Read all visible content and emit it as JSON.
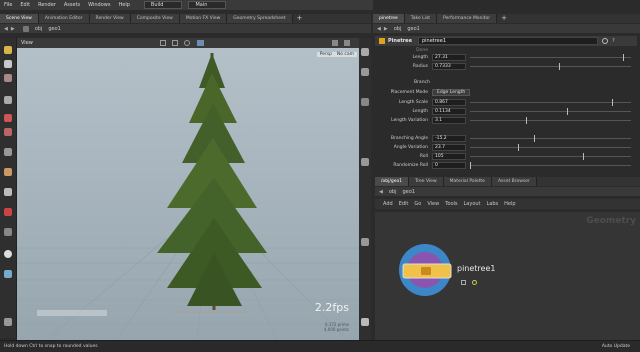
{
  "menu": [
    "File",
    "Edit",
    "Render",
    "Assets",
    "Windows",
    "Help"
  ],
  "desktop_select": "Build",
  "context_select": "Main",
  "left_tabs": [
    "Scene View",
    "Animation Editor",
    "Render View",
    "Composite View",
    "Motion FX View",
    "Geometry Spreadsheet"
  ],
  "right_tabs": [
    "pinetree",
    "Take List",
    "Performance Monitor"
  ],
  "left_path": [
    "obj",
    "geo1"
  ],
  "right_path": [
    "obj",
    "geo1"
  ],
  "vp_view_label": "View",
  "vp_persp": "Persp",
  "vp_cam": "No cam",
  "fps": "2.2fps",
  "vp_stats": [
    "6,172  prims",
    "4,000  points"
  ],
  "node_header": {
    "type": "Pinetree",
    "name": "pinetree1"
  },
  "params_top": [
    {
      "label": "Done",
      "value": ""
    },
    {
      "label": "Length",
      "value": "27.31",
      "knob": 0.95
    },
    {
      "label": "Radius",
      "value": "0.7333",
      "knob": 0.55
    }
  ],
  "section_label": "Branch",
  "placement_mode": {
    "label": "Placement Mode",
    "value": "Edge Length"
  },
  "params_mid": [
    {
      "label": "Length Scale",
      "value": "0.867",
      "knob": 0.88
    },
    {
      "label": "Length",
      "value": "0.1134",
      "knob": 0.6
    },
    {
      "label": "Length Variation",
      "value": "3.1",
      "knob": 0.35
    }
  ],
  "params_bottom": [
    {
      "label": "Branching Angle",
      "value": "-15.2",
      "knob": 0.4
    },
    {
      "label": "Angle Variation",
      "value": "23.7",
      "knob": 0.3
    },
    {
      "label": "Roll",
      "value": "105",
      "knob": 0.7
    },
    {
      "label": "Randomize Roll",
      "value": "0",
      "knob": 0.0
    }
  ],
  "net_tabs": [
    "/obj/geo1",
    "Tree View",
    "Material Palette",
    "Asset Browser"
  ],
  "net_menu": [
    "Add",
    "Edit",
    "Go",
    "View",
    "Tools",
    "Layout",
    "Labs",
    "Help"
  ],
  "net_watermark": "Geometry",
  "node_label": "pinetree1",
  "status_left": "Hold down Ctrl to snap to rounded values",
  "status_right": "Auto Update",
  "colors": {
    "accent": "#e0a21a",
    "node_ring_outer": "#3d86c8",
    "node_ring_inner": "#8a55b0",
    "node_body": "#f0c24a"
  }
}
